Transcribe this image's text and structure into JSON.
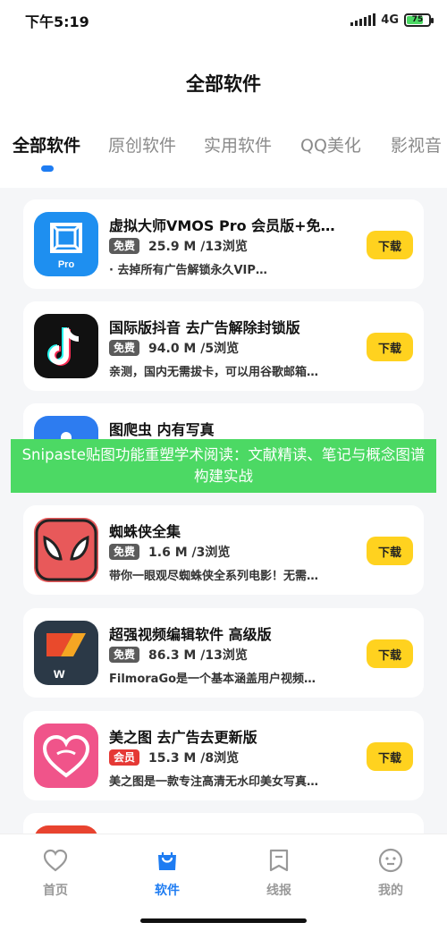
{
  "status_bar": {
    "time": "下午5:19",
    "network": "4G",
    "battery": "75",
    "battery_level": 0.75
  },
  "header": {
    "title": "全部软件"
  },
  "tabs": [
    {
      "label": "全部软件",
      "active": true
    },
    {
      "label": "原创软件",
      "active": false
    },
    {
      "label": "实用软件",
      "active": false
    },
    {
      "label": "QQ美化",
      "active": false
    },
    {
      "label": "影视音",
      "active": false
    }
  ],
  "apps": [
    {
      "name": "虚拟大师VMOS Pro 会员版+免…",
      "badge": "免费",
      "size": "25.9 M /13浏览",
      "desc": "· 去掉所有广告解锁永久VIP…",
      "download": "下载",
      "icon": "vmos-icon"
    },
    {
      "name": "国际版抖音 去广告解除封锁版",
      "badge": "免费",
      "size": "94.0 M /5浏览",
      "desc": "亲测，国内无需拔卡，可以用谷歌邮箱…",
      "download": "下载",
      "icon": "tiktok-icon"
    },
    {
      "name": "图爬虫 内有写真",
      "badge": "",
      "size": "",
      "desc": "",
      "download": "",
      "icon": "crawler-icon"
    },
    {
      "name": "蜘蛛侠全集",
      "badge": "免费",
      "size": "1.6 M /3浏览",
      "desc": "带你一眼观尽蜘蛛侠全系列电影！无需…",
      "download": "下载",
      "icon": "spiderman-icon"
    },
    {
      "name": "超强视频编辑软件 高级版",
      "badge": "免费",
      "size": "86.3 M /13浏览",
      "desc": "FilmoraGo是一个基本涵盖用户视频…",
      "download": "下载",
      "icon": "filmora-icon"
    },
    {
      "name": "美之图 去广告去更新版",
      "badge": "会员",
      "size": "15.3 M /8浏览",
      "desc": "美之图是一款专注高清无水印美女写真…",
      "download": "下载",
      "icon": "meizhitu-icon"
    },
    {
      "name": "",
      "badge": "",
      "size": "",
      "desc": "",
      "download": "",
      "icon": "partial-app-icon"
    }
  ],
  "overlay": {
    "text": "Snipaste贴图功能重塑学术阅读：文献精读、笔记与概念图谱构建实战"
  },
  "bottom_nav": [
    {
      "label": "首页",
      "icon": "heart-icon",
      "active": false
    },
    {
      "label": "软件",
      "icon": "bag-icon",
      "active": true
    },
    {
      "label": "线报",
      "icon": "bookmark-icon",
      "active": false
    },
    {
      "label": "我的",
      "icon": "smiley-icon",
      "active": false
    }
  ],
  "colors": {
    "accent": "#1e7cf2",
    "download": "#ffd21f",
    "overlay": "#4cd964",
    "vip_badge": "#e53935"
  }
}
